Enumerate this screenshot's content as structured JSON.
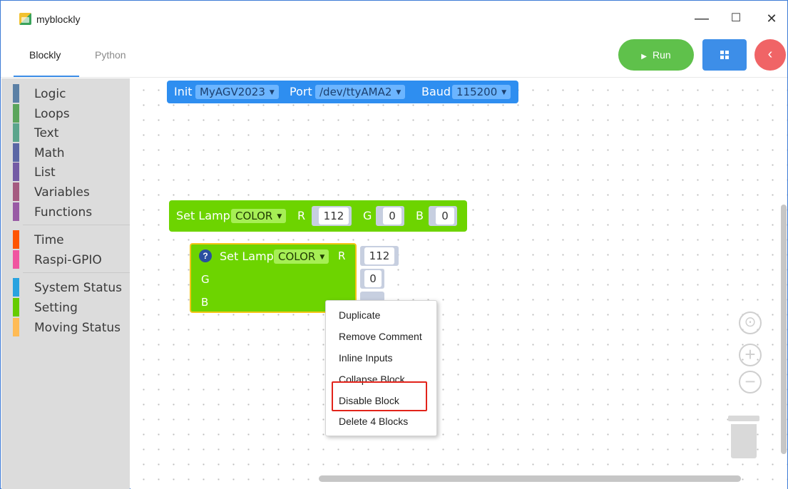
{
  "window": {
    "title": "myblockly",
    "minimize": "—",
    "maximize": "☐",
    "close": "✕"
  },
  "tabs": [
    {
      "label": "Blockly",
      "active": true
    },
    {
      "label": "Python",
      "active": false
    }
  ],
  "toolbar": {
    "run_label": "Run",
    "run_icon": "▶",
    "back_icon": "‹"
  },
  "sidebar": {
    "categories": [
      {
        "label": "Logic",
        "color": "#5b80a5"
      },
      {
        "label": "Loops",
        "color": "#5ba55b"
      },
      {
        "label": "Text",
        "color": "#5ba58c"
      },
      {
        "label": "Math",
        "color": "#5b67a5"
      },
      {
        "label": "List",
        "color": "#745ba5"
      },
      {
        "label": "Variables",
        "color": "#a55b80"
      },
      {
        "label": "Functions",
        "color": "#995ba5"
      },
      {
        "label": "Time",
        "color": "#ff5500"
      },
      {
        "label": "Raspi-GPIO",
        "color": "#f055a0"
      },
      {
        "label": "System Status",
        "color": "#29a3e0"
      },
      {
        "label": "Setting",
        "color": "#66cc00"
      },
      {
        "label": "Moving Status",
        "color": "#ffbb55"
      }
    ]
  },
  "blocks": {
    "init": {
      "label": "Init",
      "device": "MyAGV2023",
      "port_label": "Port",
      "port": "/dev/ttyAMA2",
      "baud_label": "Baud",
      "baud": "115200",
      "color": "#2e8ef0"
    },
    "set_lamp_inline": {
      "label": "Set Lamp",
      "mode": "COLOR",
      "r_label": "R",
      "r": "112",
      "g_label": "G",
      "g": "0",
      "b_label": "B",
      "b": "0",
      "color": "#6dd400"
    },
    "set_lamp_external": {
      "label": "Set Lamp",
      "mode": "COLOR",
      "r_label": "R",
      "r": "112",
      "g_label": "G",
      "g": "0",
      "b_label": "B",
      "b": "0",
      "color": "#6dd400",
      "help_icon": "?"
    }
  },
  "context_menu": {
    "items": [
      "Duplicate",
      "Remove Comment",
      "Inline Inputs",
      "Collapse Block",
      "Disable Block",
      "Delete 4 Blocks"
    ],
    "highlighted": "Disable Block"
  },
  "workspace_controls": {
    "center": "⊙",
    "zoom_in": "+",
    "zoom_out": "−"
  }
}
